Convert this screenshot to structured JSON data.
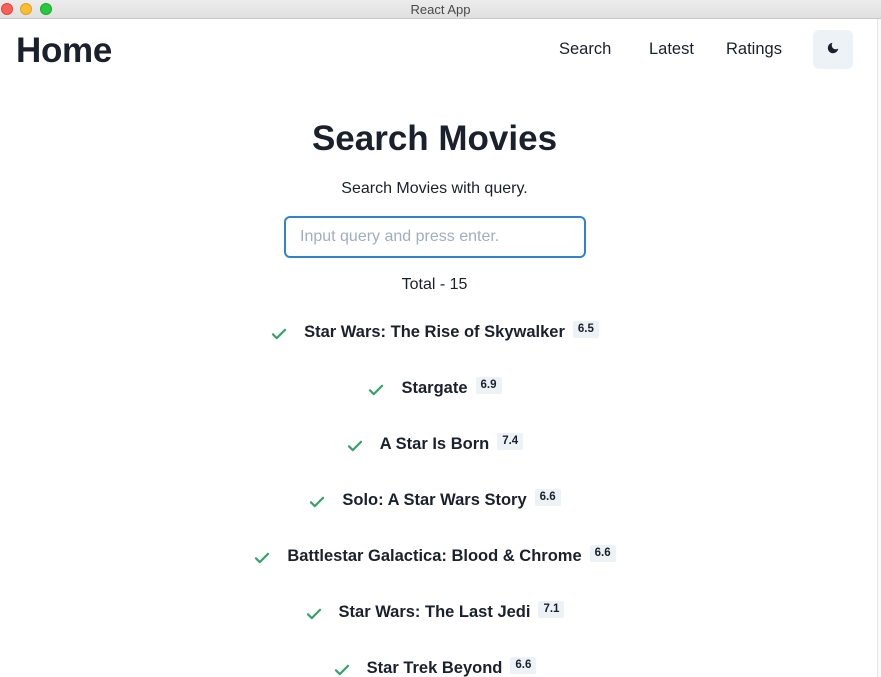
{
  "window": {
    "title": "React App"
  },
  "header": {
    "title": "Home",
    "nav": [
      {
        "label": "Search"
      },
      {
        "label": "Latest"
      },
      {
        "label": "Ratings"
      }
    ],
    "theme_toggle_icon": "moon-icon"
  },
  "main": {
    "title": "Search Movies",
    "subtitle": "Search Movies with query.",
    "search": {
      "placeholder": "Input query and press enter.",
      "value": ""
    },
    "total": "Total - 15",
    "movies": [
      {
        "title": "Star Wars: The Rise of Skywalker",
        "rating": "6.5"
      },
      {
        "title": "Stargate",
        "rating": "6.9"
      },
      {
        "title": "A Star Is Born",
        "rating": "7.4"
      },
      {
        "title": "Solo: A Star Wars Story",
        "rating": "6.6"
      },
      {
        "title": "Battlestar Galactica: Blood & Chrome",
        "rating": "6.6"
      },
      {
        "title": "Star Wars: The Last Jedi",
        "rating": "7.1"
      },
      {
        "title": "Star Trek Beyond",
        "rating": "6.6"
      }
    ]
  },
  "colors": {
    "accent": "#3182ce",
    "check": "#38a169",
    "badge_bg": "#edf2f7",
    "text": "#1a202c"
  }
}
